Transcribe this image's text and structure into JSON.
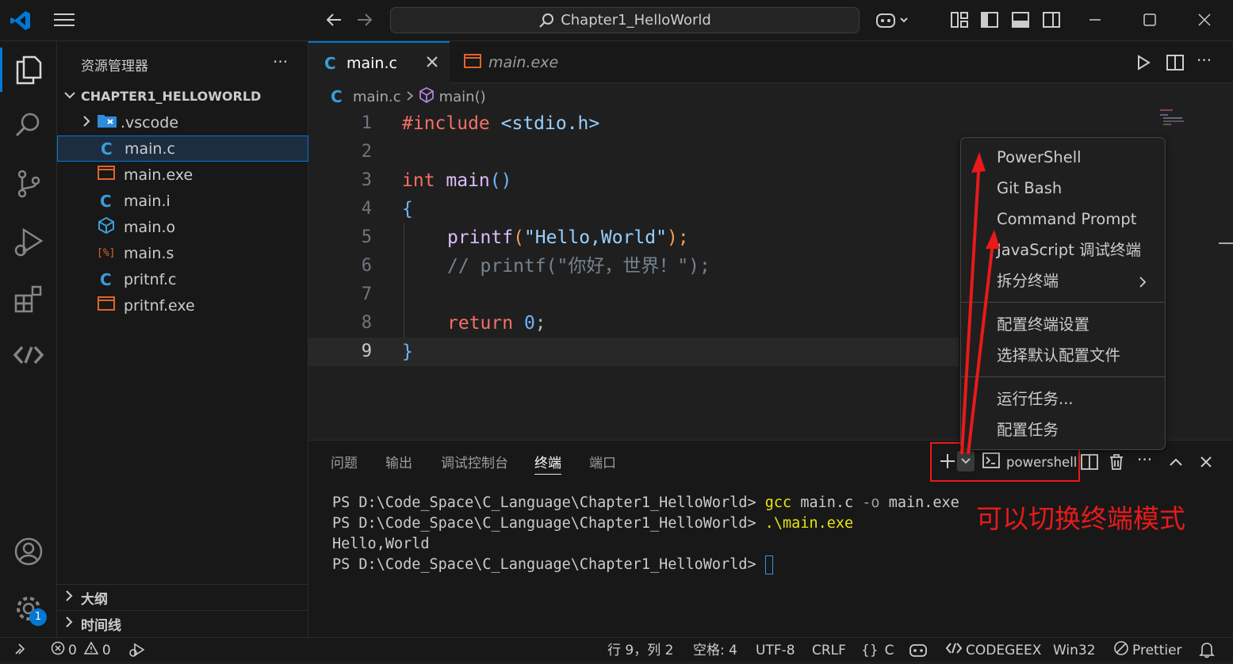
{
  "titlebar": {
    "search_text": "Chapter1_HelloWorld"
  },
  "sidebar": {
    "title": "资源管理器",
    "folder": "CHAPTER1_HELLOWORLD",
    "items": [
      ".vscode",
      "main.c",
      "main.exe",
      "main.i",
      "main.o",
      "main.s",
      "pritnf.c",
      "pritnf.exe"
    ],
    "outline": "大纲",
    "timeline": "时间线"
  },
  "editor": {
    "tabs": [
      {
        "label": "main.c"
      },
      {
        "label": "main.exe"
      }
    ],
    "breadcrumb": {
      "file": "main.c",
      "symbol": "main()"
    },
    "line_numbers": [
      "1",
      "2",
      "3",
      "4",
      "5",
      "6",
      "7",
      "8",
      "9"
    ],
    "code": {
      "l1_kw": "#include",
      "l1_rest": " <stdio.h>",
      "l3_type": "int",
      "l3_fn": " main",
      "l3_paren": "()",
      "l4": "{",
      "l5_fn": "printf",
      "l5_p1": "(",
      "l5_str": "\"Hello,World\"",
      "l5_p2": ");",
      "l6": "// printf(\"你好，世界！\");",
      "l8_kw": "return",
      "l8_num": " 0",
      "l8_semi": ";",
      "l9": "}"
    }
  },
  "menu": {
    "items": [
      "PowerShell",
      "Git Bash",
      "Command Prompt",
      "JavaScript 调试终端",
      "拆分终端",
      "配置终端设置",
      "选择默认配置文件",
      "运行任务...",
      "配置任务"
    ]
  },
  "panel": {
    "tabs": [
      "问题",
      "输出",
      "调试控制台",
      "终端",
      "端口"
    ],
    "terminal_name": "powershell",
    "prompt": "PS D:\\Code_Space\\C_Language\\Chapter1_HelloWorld>",
    "cmd1_a": "gcc",
    "cmd1_b": " main.c ",
    "cmd1_c": "-o",
    "cmd1_d": " main.exe",
    "cmd2": ".\\main.exe",
    "output": "Hello,World",
    "annotation": "可以切换终端模式"
  },
  "statusbar": {
    "errors": "0",
    "warnings": "0",
    "position": "行 9，列 2",
    "spaces": "空格: 4",
    "encoding": "UTF-8",
    "eol": "CRLF",
    "lang_braces": "{}",
    "language": "C",
    "codegeex": "CODEGEEX",
    "platform": "Win32",
    "prettier": "Prettier",
    "settings_badge": "1"
  },
  "colors": {
    "accent": "#0078d4",
    "annotation_red": "#e81a1a"
  }
}
